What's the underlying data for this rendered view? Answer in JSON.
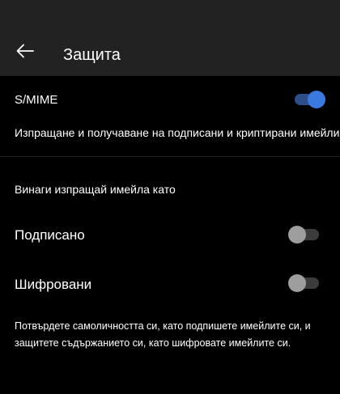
{
  "header": {
    "back_icon": "arrow-left-icon",
    "title": "Защита"
  },
  "smime": {
    "label": "S/MIME",
    "enabled": true,
    "description": "Изпращане и получаване на подписани и криптирани имейли"
  },
  "always_send": {
    "section_label": "Винаги изпращай имейла като",
    "signed": {
      "label": "Подписано",
      "enabled": false
    },
    "encrypted": {
      "label": "Шифровани",
      "enabled": false
    }
  },
  "footer": {
    "text": "Потвърдете самоличността си, като подпишете имейлите си, и защитете съдържанието си, като шифровате имейлите си."
  },
  "colors": {
    "background": "#000000",
    "header_background": "#222222",
    "toggle_on": "#3a7ae0",
    "toggle_off": "#9e9e9e"
  }
}
